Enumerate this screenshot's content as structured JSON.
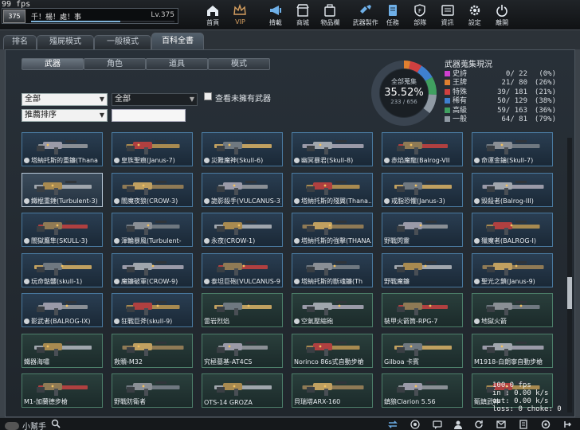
{
  "hud": {
    "fps_top": "99 fps_"
  },
  "user": {
    "rank": "375",
    "name": "千！楊！處！事",
    "level": "Lv.375",
    "xp_fraction": 0.62
  },
  "nav": [
    {
      "label": "首頁",
      "icon": "home-icon"
    },
    {
      "label": "VIP",
      "icon": "crown-icon"
    },
    {
      "label": "揹載",
      "icon": "megaphone-icon"
    },
    {
      "label": "商城",
      "icon": "shop-icon"
    },
    {
      "label": "物品欄",
      "icon": "bag-icon"
    },
    {
      "label": "武器製作",
      "icon": "forge-icon"
    },
    {
      "label": "任務",
      "icon": "scroll-icon"
    },
    {
      "label": "部隊",
      "icon": "shield-icon"
    },
    {
      "label": "資訊",
      "icon": "info-icon"
    },
    {
      "label": "設定",
      "icon": "gear-icon"
    },
    {
      "label": "離開",
      "icon": "power-icon"
    }
  ],
  "tabs": [
    "排名",
    "殭屍模式",
    "一般模式",
    "百科全書"
  ],
  "subtabs": [
    "武器",
    "角色",
    "道具",
    "模式"
  ],
  "filters": {
    "filter1": "全部",
    "filter2": "全部",
    "sort": "推薦排序",
    "checkbox_label": "查看未擁有武器"
  },
  "collection": {
    "ring_title": "全部蒐集",
    "percent": "35.52%",
    "count": "233 / 656",
    "fraction": 0.3552,
    "title": "武器蒐集現況",
    "rows": [
      {
        "name": "史詩",
        "value": "0/ 22",
        "pct": "(0%)",
        "color": "#d040d0"
      },
      {
        "name": "王牌",
        "value": "21/ 80",
        "pct": "(26%)",
        "color": "#e08030"
      },
      {
        "name": "特殊",
        "value": "39/ 181",
        "pct": "(21%)",
        "color": "#d04040"
      },
      {
        "name": "稀有",
        "value": "50/ 129",
        "pct": "(38%)",
        "color": "#3f80d0"
      },
      {
        "name": "高級",
        "value": "59/ 163",
        "pct": "(36%)",
        "color": "#40a060"
      },
      {
        "name": "一般",
        "value": "64/ 81",
        "pct": "(79%)",
        "color": "#909aa4"
      }
    ]
  },
  "weapons": [
    [
      "塔納托斯的重鐮(Thana",
      "皇族聖痕(Janus-7)",
      "災難魔神(Skull-6)",
      "幽冥暴君(Skull-8)",
      "赤焰魔龍(Balrog-VII",
      "命運金鑰(Skull-7)"
    ],
    [
      "鐵棍重錘(Turbulent-3)",
      "闇魔夜狼(CROW-3)",
      "詭影殺手(VULCANUS-3)",
      "塔納托斯的殘翼(Thana...",
      "戒脂恐懼(Janus-3)",
      "毀殺者(Balrog-III)"
    ],
    [
      "闇獄鷹隼(SKULL-3)",
      "渾輪暴風(Turbulent-",
      "永夜(CROW-1)",
      "塔納托斯的強擊(THANA...",
      "野戰閃靈",
      "獵魔者(BALROG-I)"
    ],
    [
      "玩命骷髏(skull-1)",
      "魔鐮破軍(CROW-9)",
      "泰坦巨砲(VULCANUS-9",
      "塔納托斯的斷魂鐮(Th",
      "野戰魔鐮",
      "聖光之鎖(Janus-9)"
    ],
    [
      "影武者(BALROG-IX)",
      "狂戰巨斧(skull-9)",
      "雷岩烈焰",
      "空氣壓縮砲",
      "裝甲火箭筒-RPG-7",
      "地獄火箭"
    ],
    [
      "鐵器海嘯",
      "救贖-M32",
      "究極墓基-AT4CS",
      "Norinco 86s式自動步槍",
      "Gilboa 卡賓",
      "M1918-白朗寧自動步槍"
    ],
    [
      "M1-加蘭德步槍",
      "野戰防衛者",
      "OTS-14 GROZA",
      "貝瑞塔ARX-160",
      "鎮狼Clarion 5.56",
      "甄鎮武神"
    ]
  ],
  "netstats": {
    "fps": "100.0 fps",
    "in": "in : 0.00 k/s",
    "out": "out: 0.00 k/s",
    "loss": "loss: 0 choke: 0"
  },
  "bottom": {
    "helper_label": "小幫手"
  }
}
